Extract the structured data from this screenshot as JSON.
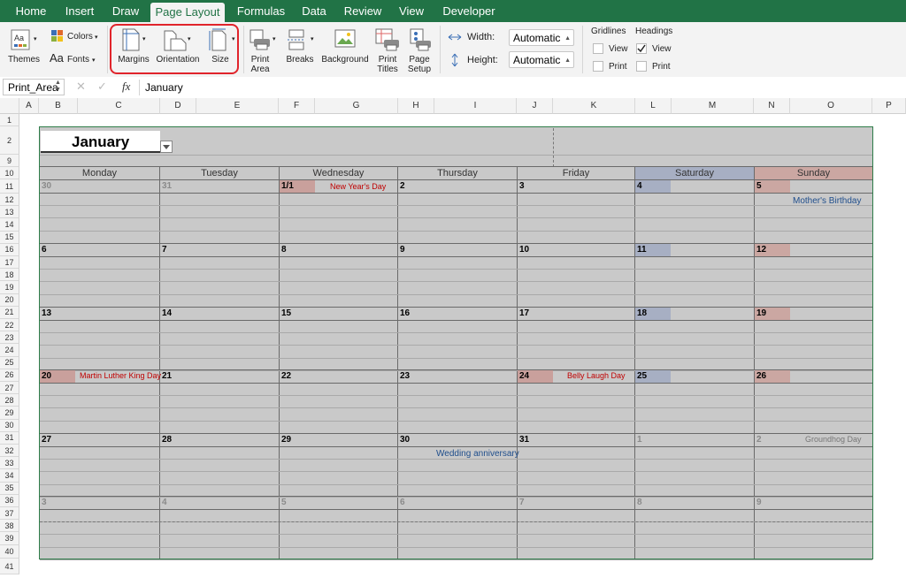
{
  "ribbon_tabs": [
    "Home",
    "Insert",
    "Draw",
    "Page Layout",
    "Formulas",
    "Data",
    "Review",
    "View",
    "Developer"
  ],
  "active_tab": "Page Layout",
  "ribbon": {
    "themes": "Themes",
    "colors": "Colors",
    "fonts": "Fonts",
    "margins": "Margins",
    "orientation": "Orientation",
    "size": "Size",
    "print_area": "Print Area",
    "breaks": "Breaks",
    "background": "Background",
    "print_titles": "Print Titles",
    "page_setup": "Page Setup",
    "width_label": "Width:",
    "width_value": "Automatic",
    "height_label": "Height:",
    "height_value": "Automatic",
    "gridlines": "Gridlines",
    "headings": "Headings",
    "view": "View",
    "print": "Print",
    "gridlines_view_checked": false,
    "gridlines_print_checked": false,
    "headings_view_checked": true,
    "headings_print_checked": false
  },
  "formula_bar": {
    "name_box": "Print_Area",
    "fx": "fx",
    "value": "January"
  },
  "columns": [
    "A",
    "B",
    "C",
    "D",
    "E",
    "F",
    "G",
    "H",
    "I",
    "J",
    "K",
    "L",
    "M",
    "N",
    "O",
    "P"
  ],
  "rows": [
    "1",
    "2",
    "9",
    "10",
    "11",
    "12",
    "13",
    "14",
    "15",
    "16",
    "17",
    "18",
    "19",
    "20",
    "21",
    "22",
    "23",
    "24",
    "25",
    "26",
    "27",
    "28",
    "29",
    "30",
    "31",
    "32",
    "33",
    "34",
    "35",
    "36",
    "37",
    "38",
    "39",
    "40",
    "41"
  ],
  "calendar": {
    "month": "January",
    "days": [
      "Monday",
      "Tuesday",
      "Wednesday",
      "Thursday",
      "Friday",
      "Saturday",
      "Sunday"
    ],
    "weeks": [
      [
        "30",
        "31",
        "1/1",
        "2",
        "3",
        "4",
        "5"
      ],
      [
        "6",
        "7",
        "8",
        "9",
        "10",
        "11",
        "12"
      ],
      [
        "13",
        "14",
        "15",
        "16",
        "17",
        "18",
        "19"
      ],
      [
        "20",
        "21",
        "22",
        "23",
        "24",
        "25",
        "26"
      ],
      [
        "27",
        "28",
        "29",
        "30",
        "31",
        "1",
        "2"
      ],
      [
        "3",
        "4",
        "5",
        "6",
        "7",
        "8",
        "9"
      ]
    ],
    "events": {
      "new_years": "New Year's Day",
      "mothers_birthday": "Mother's Birthday",
      "mlk_day": "Martin Luther King Day",
      "belly_laugh": "Belly Laugh Day",
      "wedding": "Wedding anniversary",
      "groundhog": "Groundhog Day"
    }
  },
  "colors": {
    "accent": "#217346",
    "saturday": "#a7afc3",
    "sunday": "#cba7a2",
    "holiday": "#c9a09c",
    "cell": "#c9c9c9",
    "highlight": "#e0242b"
  }
}
